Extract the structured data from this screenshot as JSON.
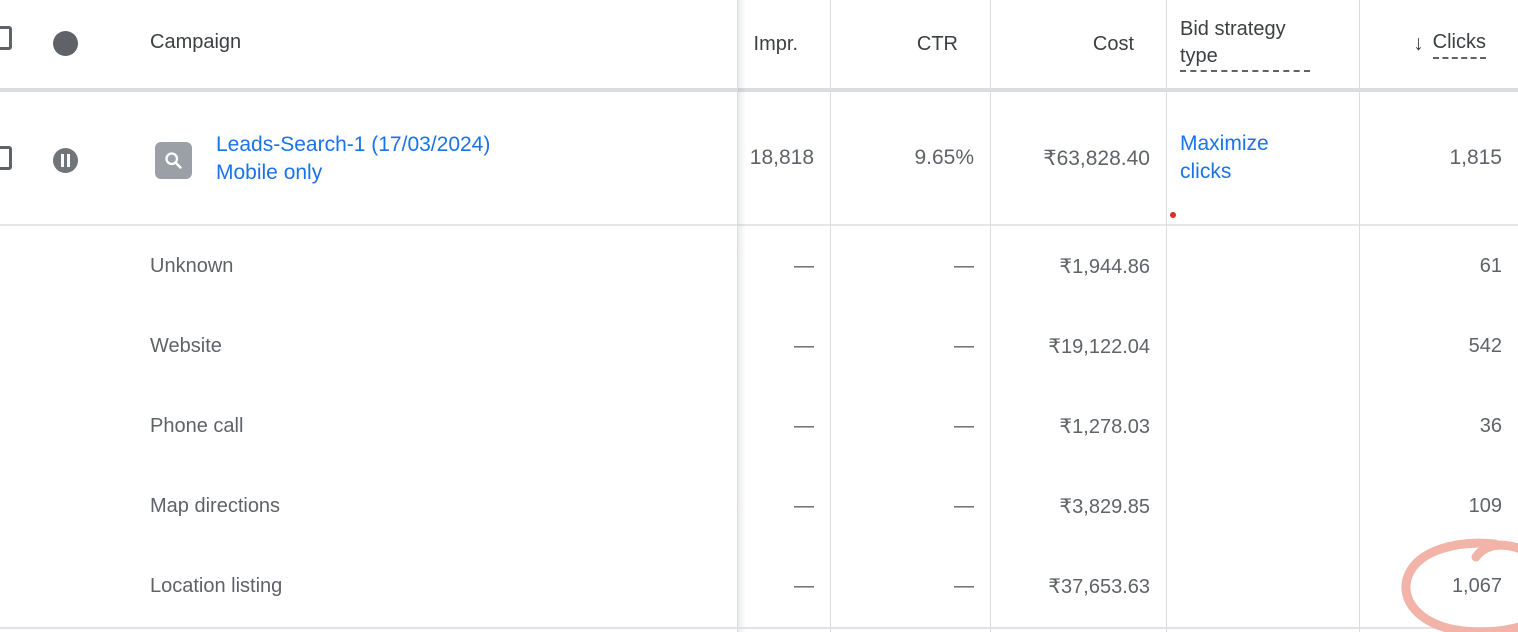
{
  "table": {
    "columns": [
      {
        "key": "campaign",
        "label": "Campaign",
        "align": "left",
        "dashed": false,
        "sorted": false
      },
      {
        "key": "impr",
        "label": "Impr.",
        "align": "right",
        "dashed": false,
        "sorted": false
      },
      {
        "key": "ctr",
        "label": "CTR",
        "align": "right",
        "dashed": false,
        "sorted": false
      },
      {
        "key": "cost",
        "label": "Cost",
        "align": "right",
        "dashed": false,
        "sorted": false
      },
      {
        "key": "bid",
        "label": "Bid strategy type",
        "align": "left",
        "dashed": true,
        "sorted": false
      },
      {
        "key": "clicks",
        "label": "Clicks",
        "align": "right",
        "dashed": true,
        "sorted": true,
        "sort_direction": "descending",
        "sort_arrow": "↓"
      }
    ],
    "header": {
      "select_all_checkbox": "",
      "status_icon": "status-circle-icon",
      "campaign_label": "Campaign",
      "impr_label": "Impr.",
      "ctr_label": "CTR",
      "cost_label": "Cost",
      "bid_label": "Bid strategy type",
      "clicks_label": "Clicks",
      "sort_arrow": "↓"
    },
    "campaign_row": {
      "checkbox_checked": false,
      "status_icon": "pause-icon",
      "status": "Paused",
      "type_icon": "search-campaign-icon",
      "name": "Leads-Search-1 (17/03/2024)",
      "subtitle": "Mobile only",
      "impr": "18,818",
      "ctr": "9.65%",
      "cost": "₹63,828.40",
      "bid_strategy_type": "Maximize clicks",
      "bid_has_notification": true,
      "clicks": "1,815"
    },
    "breakdown_rows": [
      {
        "label": "Unknown",
        "impr": "—",
        "ctr": "—",
        "cost": "₹1,944.86",
        "bid": "",
        "clicks": "61",
        "highlighted": false
      },
      {
        "label": "Website",
        "impr": "—",
        "ctr": "—",
        "cost": "₹19,122.04",
        "bid": "",
        "clicks": "542",
        "highlighted": false
      },
      {
        "label": "Phone call",
        "impr": "—",
        "ctr": "—",
        "cost": "₹1,278.03",
        "bid": "",
        "clicks": "36",
        "highlighted": false
      },
      {
        "label": "Map directions",
        "impr": "—",
        "ctr": "—",
        "cost": "₹3,829.85",
        "bid": "",
        "clicks": "109",
        "highlighted": false
      },
      {
        "label": "Location listing",
        "impr": "—",
        "ctr": "—",
        "cost": "₹37,653.63",
        "bid": "",
        "clicks": "1,067",
        "highlighted": true
      }
    ]
  },
  "annotation": {
    "shape": "hand-drawn-circle",
    "target_value": "1,067",
    "target_column": "Clicks",
    "color": "#f2b3a8"
  },
  "colors": {
    "link": "#1a73e8",
    "text_primary": "#3c4043",
    "text_secondary": "#5f6368",
    "border": "#dadce0",
    "status_icon": "#70757a",
    "type_icon_bg": "#9aa0a6",
    "notification_dot": "#d93025",
    "annotation": "#f2b3a8"
  }
}
